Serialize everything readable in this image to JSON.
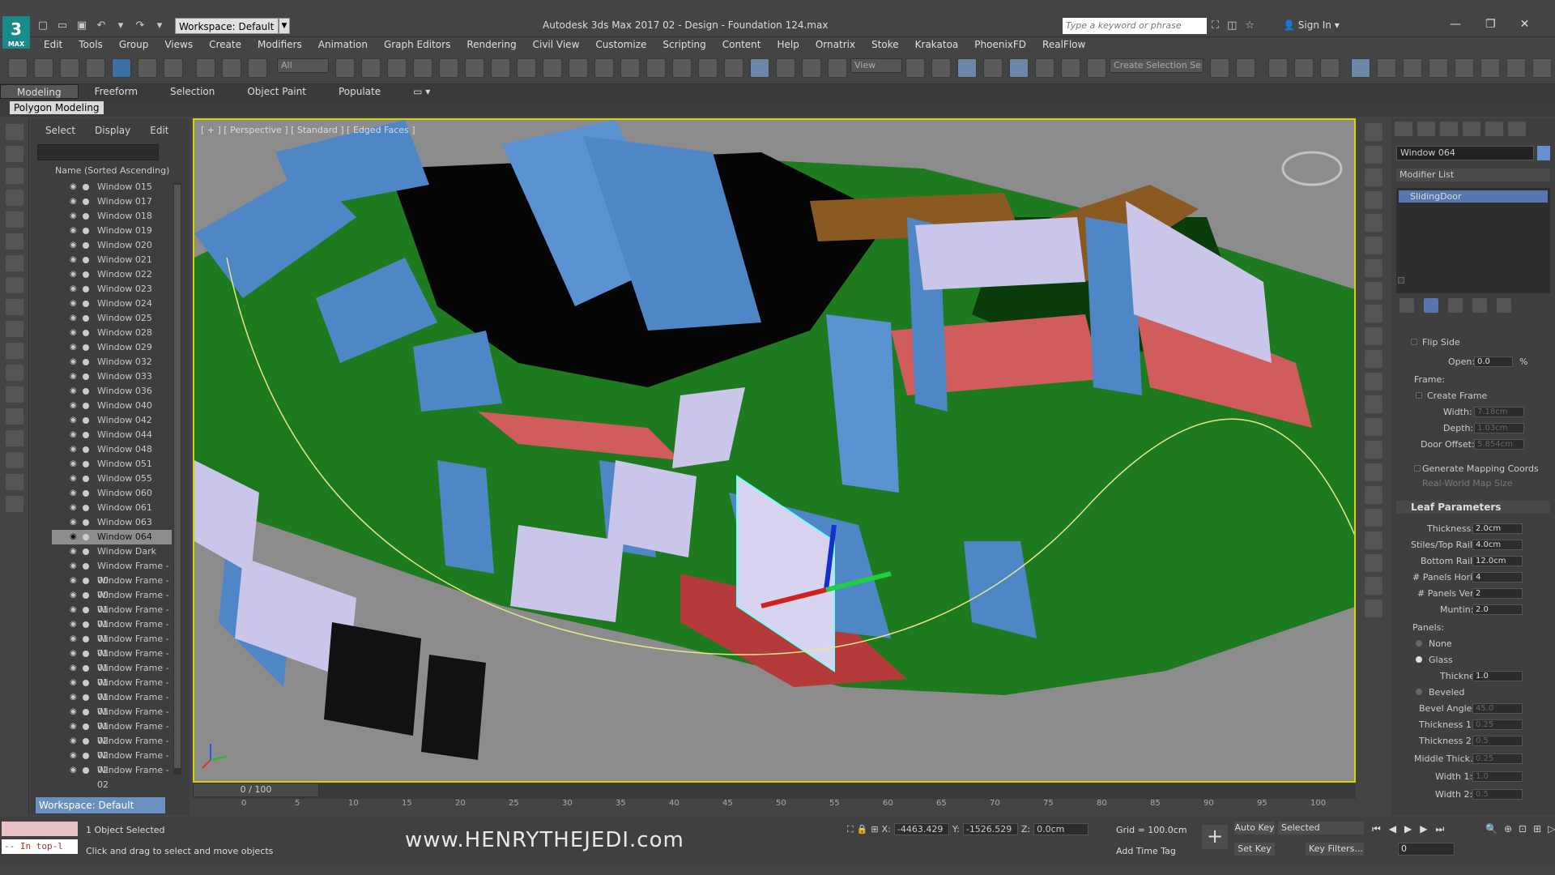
{
  "app": {
    "logo_text": "3",
    "logo_sub": "MAX",
    "title": "Autodesk 3ds Max 2017     02 - Design - Foundation 124.max",
    "workspace": "Workspace: Default",
    "search_placeholder": "Type a keyword or phrase",
    "sign_in": "Sign In"
  },
  "menu": [
    "Edit",
    "Tools",
    "Group",
    "Views",
    "Create",
    "Modifiers",
    "Animation",
    "Graph Editors",
    "Rendering",
    "Civil View",
    "Customize",
    "Scripting",
    "Content",
    "Help",
    "Ornatrix",
    "Stoke",
    "Krakatoa",
    "PhoenixFD",
    "RealFlow"
  ],
  "toolbar": {
    "filter": "All",
    "ref_coord": "View",
    "named_selection": "Create Selection Se"
  },
  "ribbon": {
    "tabs": [
      "Modeling",
      "Freeform",
      "Selection",
      "Object Paint",
      "Populate"
    ],
    "active": "Modeling",
    "panel": "Polygon Modeling"
  },
  "scene_explorer": {
    "tabs": [
      "Select",
      "Display",
      "Edit"
    ],
    "column": "Name (Sorted Ascending)",
    "rows": [
      "Window 015",
      "Window 017",
      "Window 018",
      "Window 019",
      "Window 020",
      "Window 021",
      "Window 022",
      "Window 023",
      "Window 024",
      "Window 025",
      "Window 028",
      "Window 029",
      "Window 032",
      "Window 033",
      "Window 036",
      "Window 040",
      "Window 042",
      "Window 044",
      "Window 048",
      "Window 051",
      "Window 055",
      "Window 060",
      "Window 061",
      "Window 063",
      "Window 064",
      "Window Dark",
      "Window Frame - 00",
      "Window Frame - 00",
      "Window Frame - 01",
      "Window Frame - 01",
      "Window Frame - 01",
      "Window Frame - 01",
      "Window Frame - 01",
      "Window Frame - 01",
      "Window Frame - 01",
      "Window Frame - 01",
      "Window Frame - 01",
      "Window Frame - 02",
      "Window Frame - 02",
      "Window Frame - 02",
      "Window Frame - 02"
    ],
    "selected": "Window 064",
    "workspace": "Workspace: Default"
  },
  "viewport": {
    "label": "[ + ] [ Perspective ] [ Standard ] [ Edged Faces ]"
  },
  "command_panel": {
    "object_name": "Window 064",
    "modifier_list": "Modifier List",
    "stack_item": "SlidingDoor",
    "flip_side": "Flip Side",
    "open_label": "Open:",
    "open_value": "0.0",
    "open_unit": "%",
    "frame_label": "Frame:",
    "create_frame": "Create Frame",
    "width_label": "Width:",
    "width_value": "7.18cm",
    "depth_label": "Depth:",
    "depth_value": "1.03cm",
    "door_offset_label": "Door Offset:",
    "door_offset_value": "5.854cm",
    "gen_mapping": "Generate Mapping Coords",
    "real_world": "Real-World Map Size",
    "leaf_title": "Leaf Parameters",
    "thickness_label": "Thickness:",
    "thickness_value": "2.0cm",
    "stiles_label": "Stiles/Top Rail:",
    "stiles_value": "4.0cm",
    "bottom_label": "Bottom Rail:",
    "bottom_value": "12.0cm",
    "ph_label": "# Panels Horiz:",
    "ph_value": "4",
    "pv_label": "# Panels Vert:",
    "pv_value": "2",
    "muntin_label": "Muntin:",
    "muntin_value": "2.0",
    "panels_label": "Panels:",
    "none_label": "None",
    "glass_label": "Glass",
    "glass_thk_label": "Thickness:",
    "glass_thk_value": "1.0",
    "beveled_label": "Beveled",
    "bevel_angle_label": "Bevel Angle:",
    "bevel_angle_value": "45.0",
    "thk1_label": "Thickness 1:",
    "thk1_value": "0.25",
    "thk2_label": "Thickness 2:",
    "thk2_value": "0.5",
    "middle_label": "Middle Thick.:",
    "middle_value": "0.25",
    "w1_label": "Width 1:",
    "w1_value": "1.0",
    "w2_label": "Width 2:",
    "w2_value": "0.5"
  },
  "timeline": {
    "slider": "0 / 100",
    "ticks": [
      "0",
      "5",
      "10",
      "15",
      "20",
      "25",
      "30",
      "35",
      "40",
      "45",
      "50",
      "55",
      "60",
      "65",
      "70",
      "75",
      "80",
      "85",
      "90",
      "95",
      "100"
    ]
  },
  "status": {
    "maxscript": "-- In top-l",
    "count": "1 Object Selected",
    "prompt": "Click and drag to select and move objects",
    "watermark": "www.HENRYTHEJEDI.com",
    "x_label": "X:",
    "x_value": "-4463.429",
    "y_label": "Y:",
    "y_value": "-1526.529",
    "z_label": "Z:",
    "z_value": "0.0cm",
    "grid": "Grid = 100.0cm",
    "add_time_tag": "Add Time Tag",
    "auto_key": "Auto Key",
    "set_key": "Set Key",
    "selected": "Selected",
    "key_filters": "Key Filters...",
    "frame": "0"
  }
}
